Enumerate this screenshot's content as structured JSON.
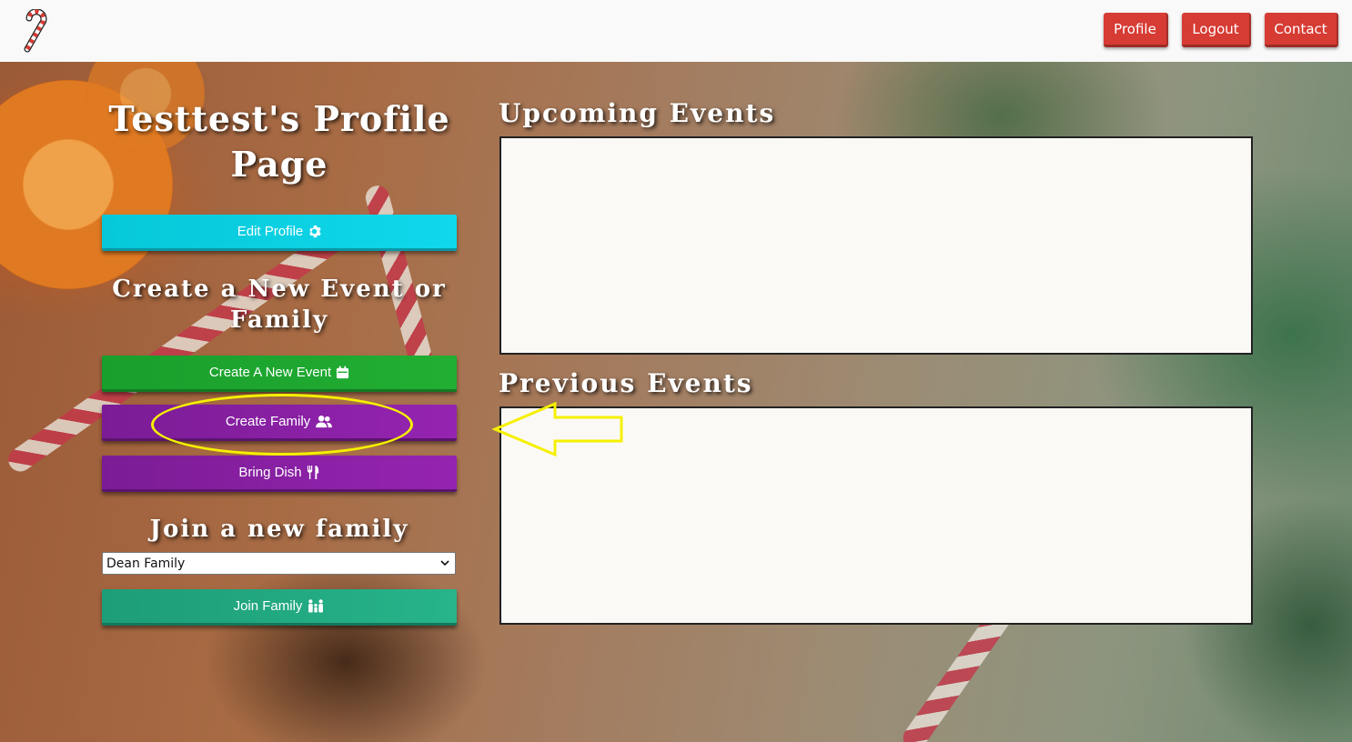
{
  "nav": {
    "logo_icon": "candy-cane-icon",
    "profile_label": "Profile",
    "logout_label": "Logout",
    "contact_label": "Contact",
    "button_color": "#d63b34"
  },
  "left": {
    "title": "Testtest's Profile Page",
    "edit_profile_label": "Edit Profile",
    "edit_profile_icon": "gear-icon",
    "create_heading": "Create a New Event or Family",
    "create_event_label": "Create A New Event",
    "create_event_icon": "calendar-icon",
    "create_family_label": "Create Family",
    "create_family_icon": "users-icon",
    "bring_dish_label": "Bring Dish",
    "bring_dish_icon": "utensils-icon",
    "join_heading": "Join a new family",
    "family_select_value": "Dean Family",
    "join_family_label": "Join Family",
    "join_family_icon": "family-icon"
  },
  "right": {
    "upcoming_heading": "Upcoming Events",
    "previous_heading": "Previous Events"
  },
  "annotation": {
    "color": "#f5f000",
    "target": "Create Family"
  }
}
